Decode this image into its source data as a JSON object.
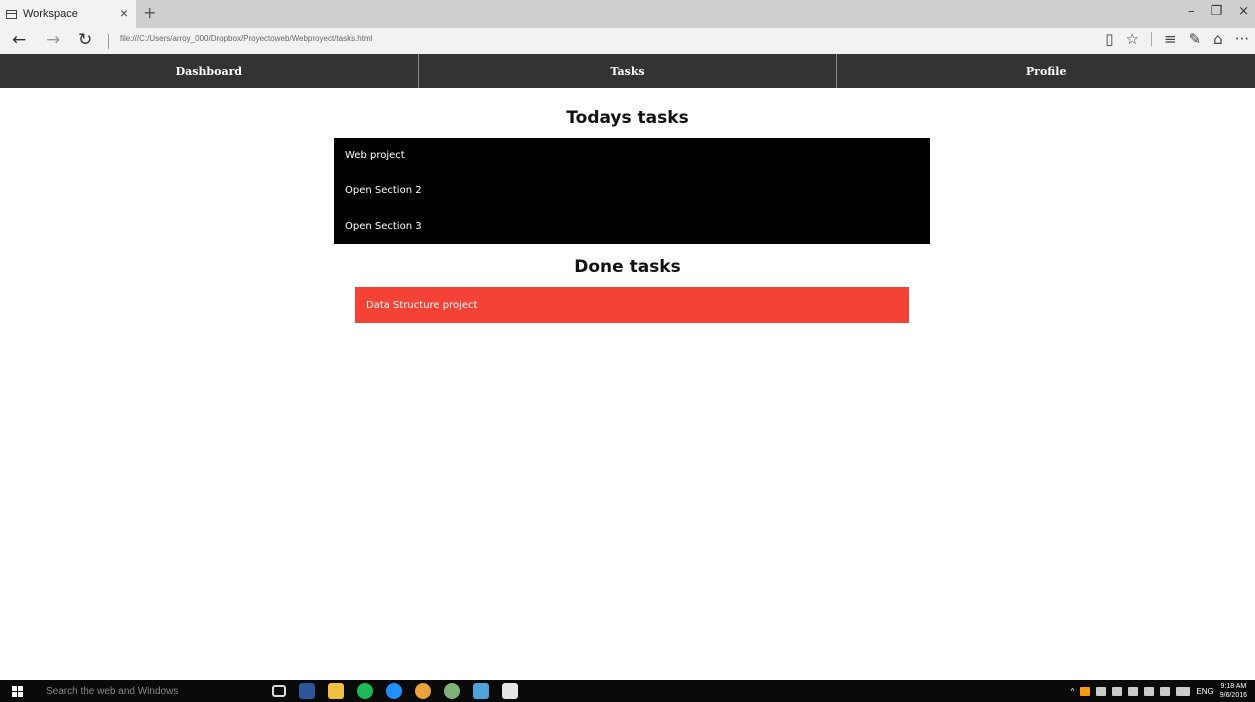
{
  "browser": {
    "tab_title": "Workspace",
    "tab_close": "×",
    "new_tab": "+",
    "url": "file:///C:/Users/arroy_000/Dropbox/Proyectoweb/Webproyect/tasks.html",
    "back": "←",
    "forward": "→",
    "refresh": "↻",
    "window_controls": {
      "minimize": "–",
      "restore": "❐",
      "close": "×"
    },
    "toolbar_icons": {
      "reading_view": "▯",
      "favorites": "☆",
      "hub": "≡",
      "note": "✎",
      "share": "⌂",
      "more": "···"
    }
  },
  "site_nav": {
    "items": [
      {
        "label": "Dashboard"
      },
      {
        "label": "Tasks"
      },
      {
        "label": "Profile"
      }
    ]
  },
  "todays": {
    "title": "Todays tasks",
    "items": [
      {
        "label": "Web project"
      },
      {
        "label": "Open Section 2"
      },
      {
        "label": "Open Section 3"
      }
    ]
  },
  "done": {
    "title": "Done tasks",
    "items": [
      {
        "label": "Data Structure project"
      }
    ]
  },
  "taskbar": {
    "search_placeholder": "Search the web and Windows",
    "tray_lang": "ENG",
    "time": "9:18 AM",
    "date": "9/6/2016",
    "tray_caret": "^"
  },
  "colors": {
    "nav_bg": "#333333",
    "todays_bg": "#000000",
    "done_bg": "#f44336"
  }
}
